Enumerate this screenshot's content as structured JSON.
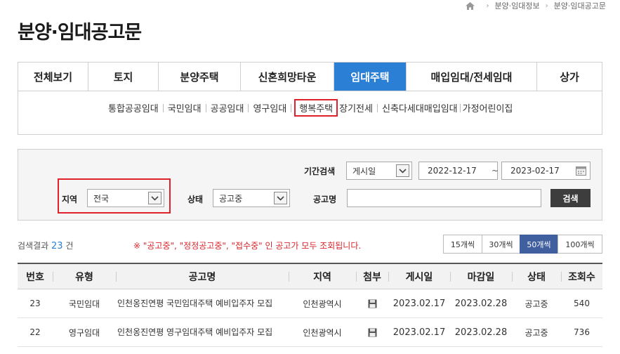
{
  "breadcrumb": {
    "items": [
      "분양·임대정보",
      "분양·임대공고문"
    ]
  },
  "page_title": "분양·임대공고문",
  "tabs": [
    {
      "label": "전체보기"
    },
    {
      "label": "토지"
    },
    {
      "label": "분양주택"
    },
    {
      "label": "신혼희망타운"
    },
    {
      "label": "임대주택"
    },
    {
      "label": "매입임대/전세임대"
    },
    {
      "label": "상가"
    }
  ],
  "active_tab": "임대주택",
  "subtabs": [
    {
      "label": "통합공공임대"
    },
    {
      "label": "국민임대"
    },
    {
      "label": "공공임대"
    },
    {
      "label": "영구임대"
    },
    {
      "label": "행복주택"
    },
    {
      "label": "장기전세"
    },
    {
      "label": "신축다세대매입임대"
    },
    {
      "label": "가정어린이집"
    }
  ],
  "highlighted_subtab": "행복주택",
  "search": {
    "period_label": "기간검색",
    "period_type": "게시일",
    "date_from": "2022-12-17",
    "date_sep": "~",
    "date_to": "2023-02-17",
    "region_label": "지역",
    "region_value": "전국",
    "status_label": "상태",
    "status_value": "공고중",
    "title_label": "공고명",
    "title_value": "",
    "search_button": "검색"
  },
  "results": {
    "prefix": "검색결과",
    "count": "23",
    "suffix": "건",
    "notice": "※ \"공고중\", \"정정공고중\", \"접수중\" 인 공고가 모두 조회됩니다."
  },
  "page_size_options": [
    "15개씩",
    "30개씩",
    "50개씩",
    "100개씩"
  ],
  "page_size_selected": "50개씩",
  "table": {
    "headers": [
      "번호",
      "유형",
      "공고명",
      "지역",
      "첨부",
      "게시일",
      "마감일",
      "상태",
      "조회수"
    ],
    "rows": [
      {
        "no": "23",
        "type": "국민임대",
        "title": "인천옹진연평 국민임대주택 예비입주자 모집",
        "region": "인천광역시",
        "posted": "2023.02.17",
        "deadline": "2023.02.28",
        "status": "공고중",
        "views": "540"
      },
      {
        "no": "22",
        "type": "영구임대",
        "title": "인천옹진연평 영구임대주택 예비입주자 모집",
        "region": "인천광역시",
        "posted": "2023.02.17",
        "deadline": "2023.02.28",
        "status": "공고중",
        "views": "736"
      }
    ]
  },
  "colors": {
    "accent": "#2b7fd4",
    "highlight_outline": "#e0202a",
    "notice": "#d9262c",
    "page_size_active": "#3f5f9e",
    "search_button": "#3d3d3d"
  }
}
